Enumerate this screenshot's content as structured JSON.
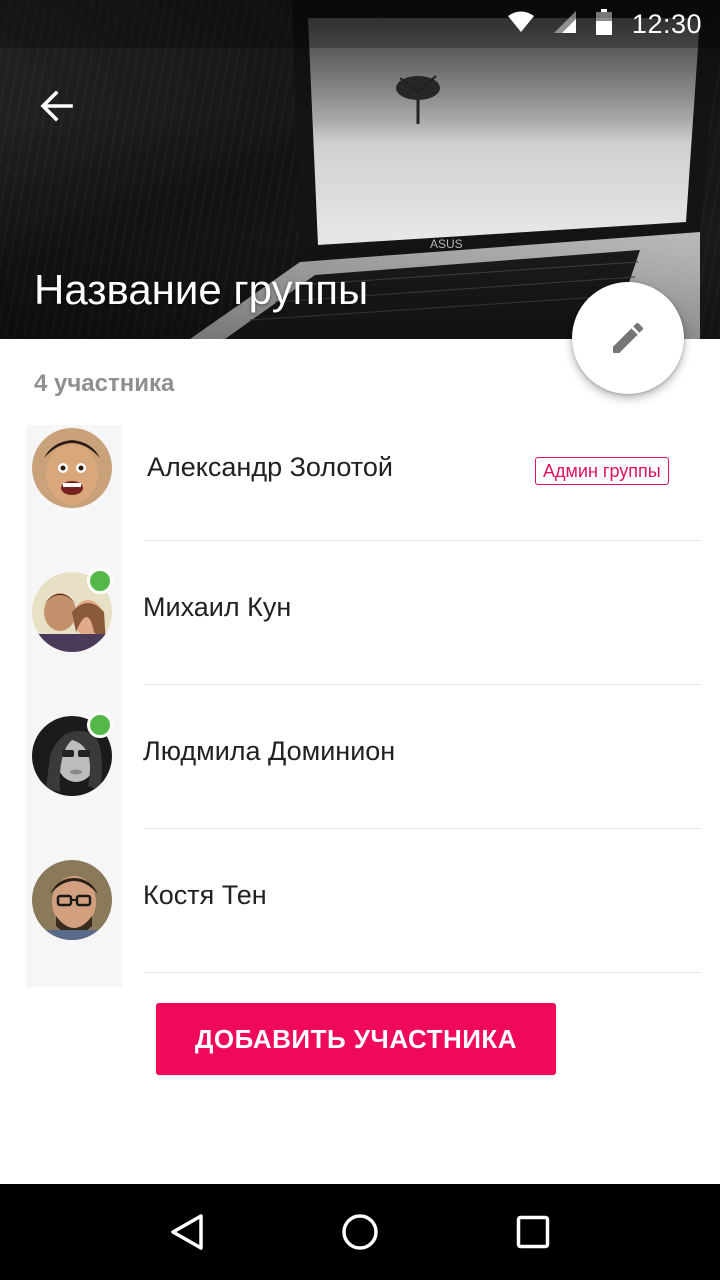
{
  "status_bar": {
    "time": "12:30",
    "icons": [
      "wifi-icon",
      "signal-icon",
      "battery-icon"
    ]
  },
  "header": {
    "group_name": "Название группы",
    "back_icon": "arrow-left-icon",
    "edit_icon": "pencil-icon"
  },
  "members_section": {
    "count_label": "4 участника",
    "members": [
      {
        "name": "Александр Золотой",
        "online": false,
        "badge": "Админ группы"
      },
      {
        "name": "Михаил Кун",
        "online": true
      },
      {
        "name": "Людмила Доминион",
        "online": true
      },
      {
        "name": "Костя Тен",
        "online": false
      }
    ]
  },
  "actions": {
    "add_member_label": "ДОБАВИТЬ УЧАСТНИКА"
  },
  "nav_bar": {
    "icons": [
      "back-triangle-icon",
      "home-circle-icon",
      "recents-square-icon"
    ]
  },
  "colors": {
    "accent": "#f0085b",
    "online": "#54b948"
  }
}
